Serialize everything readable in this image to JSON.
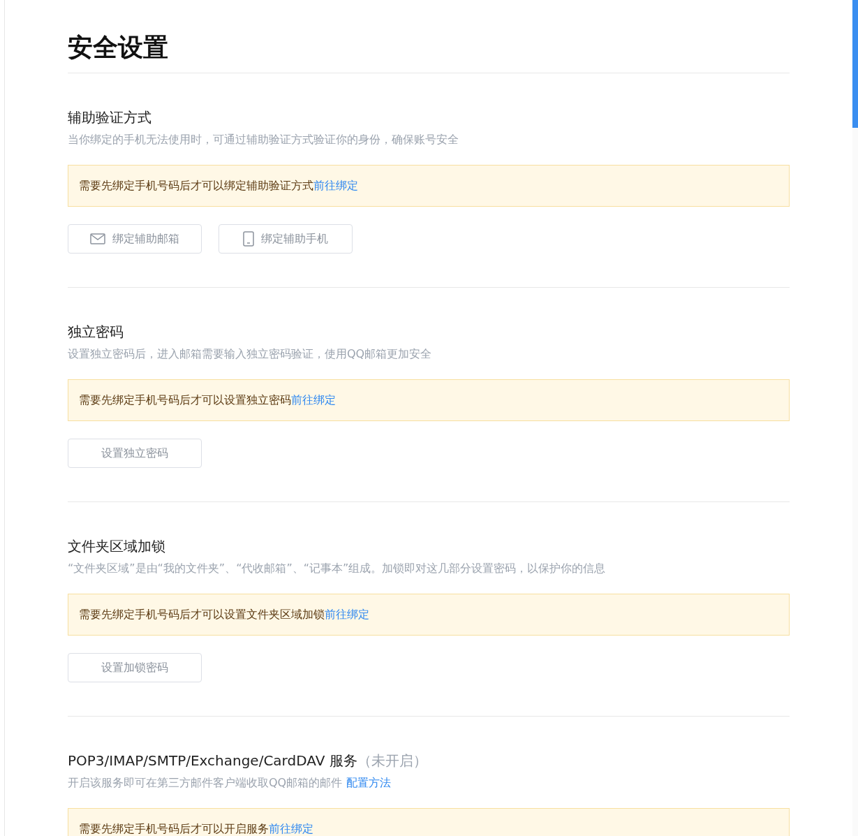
{
  "title": "安全设置",
  "sections": [
    {
      "heading": "辅助验证方式",
      "description": "当你绑定的手机无法使用时，可通过辅助验证方式验证你的身份，确保账号安全",
      "notice": {
        "text": "需要先绑定手机号码后才可以绑定辅助验证方式",
        "link": "前往绑定"
      },
      "buttons": [
        {
          "label": "绑定辅助邮箱",
          "kind": "mail",
          "disabled": true
        },
        {
          "label": "绑定辅助手机",
          "kind": "phone",
          "disabled": true
        }
      ]
    },
    {
      "heading": "独立密码",
      "description": "设置独立密码后，进入邮箱需要输入独立密码验证，使用QQ邮箱更加安全",
      "notice": {
        "text": "需要先绑定手机号码后才可以设置独立密码",
        "link": "前往绑定"
      },
      "buttons": [
        {
          "label": "设置独立密码",
          "kind": "plain",
          "disabled": true
        }
      ]
    },
    {
      "heading": "文件夹区域加锁",
      "description": "“文件夹区域”是由“我的文件夹”、“代收邮箱”、“记事本”组成。加锁即对这几部分设置密码，以保护你的信息",
      "notice": {
        "text": "需要先绑定手机号码后才可以设置文件夹区域加锁",
        "link": "前往绑定"
      },
      "buttons": [
        {
          "label": "设置加锁密码",
          "kind": "plain",
          "disabled": true
        }
      ]
    },
    {
      "heading": "POP3/IMAP/SMTP/Exchange/CardDAV 服务",
      "status": "（未开启）",
      "description": "开启该服务即可在第三方邮件客户端收取QQ邮箱的邮件",
      "description_link": "配置方法",
      "notice": {
        "text": "需要先绑定手机号码后才可以开启服务",
        "link": "前往绑定"
      }
    }
  ]
}
